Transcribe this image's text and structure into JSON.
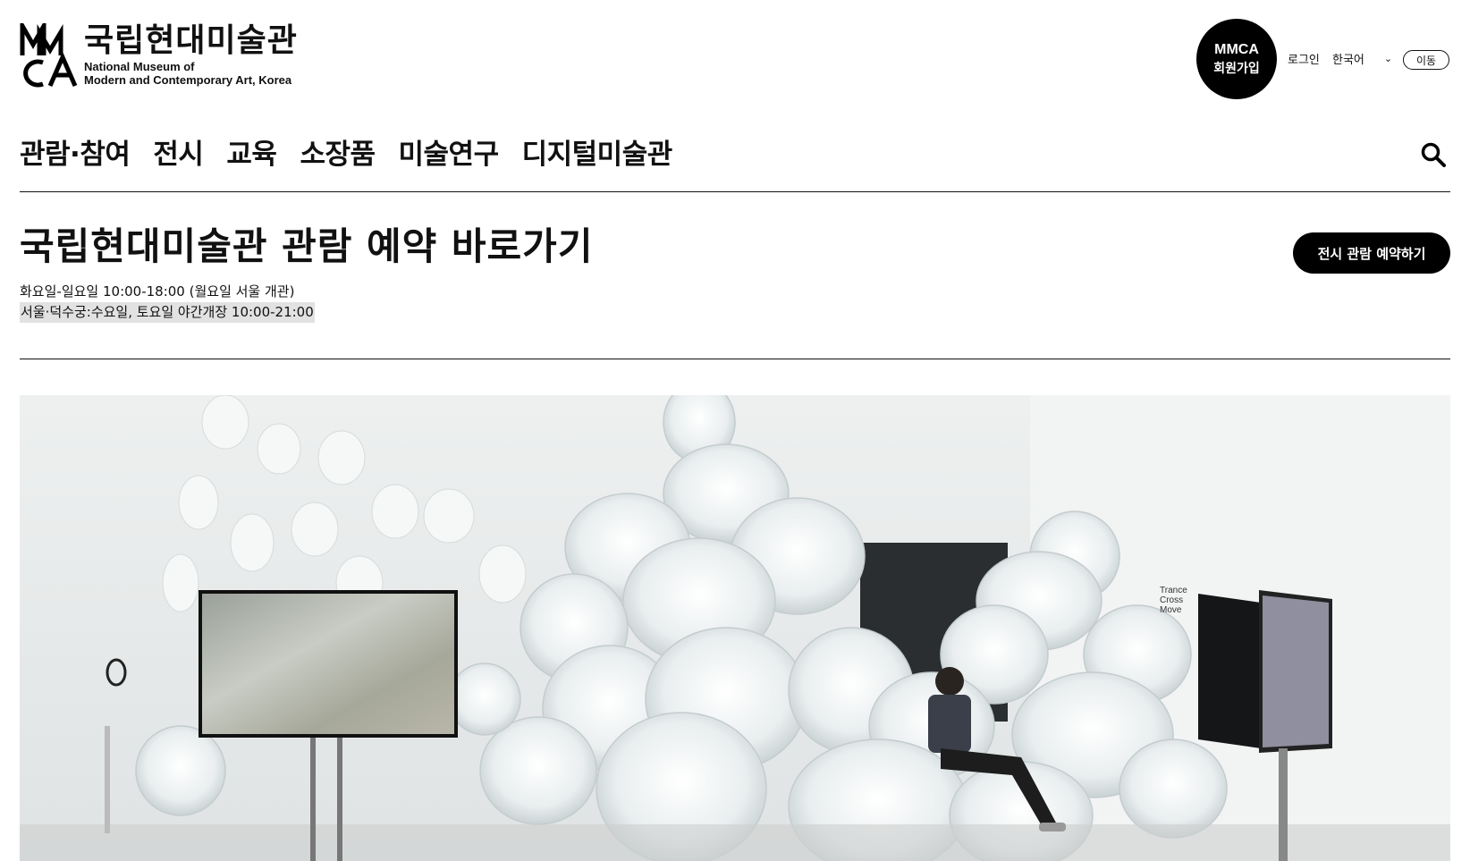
{
  "logo": {
    "mark_text": "MMCA",
    "korean": "국립현대미술관",
    "english_line1": "National Museum of",
    "english_line2": "Modern and Contemporary Art, Korea"
  },
  "utility": {
    "member_line1": "MMCA",
    "member_line2": "회원가입",
    "login": "로그인",
    "language": "한국어",
    "go": "이동"
  },
  "nav": {
    "items": [
      "관람·참여",
      "전시",
      "교육",
      "소장품",
      "미술연구",
      "디지털미술관"
    ]
  },
  "reservation": {
    "title": "국립현대미술관 관람 예약 바로가기",
    "hours": "화요일-일요일 10:00-18:00 (월요일 서울 개관)",
    "late_hours": "서울·덕수궁:수요일, 토요일 야간개장 10:00-21:00",
    "button": "전시 관람 예약하기"
  },
  "hero": {
    "wall_text_line1": "Trance",
    "wall_text_line2": "Cross",
    "wall_text_line3": "Move"
  }
}
